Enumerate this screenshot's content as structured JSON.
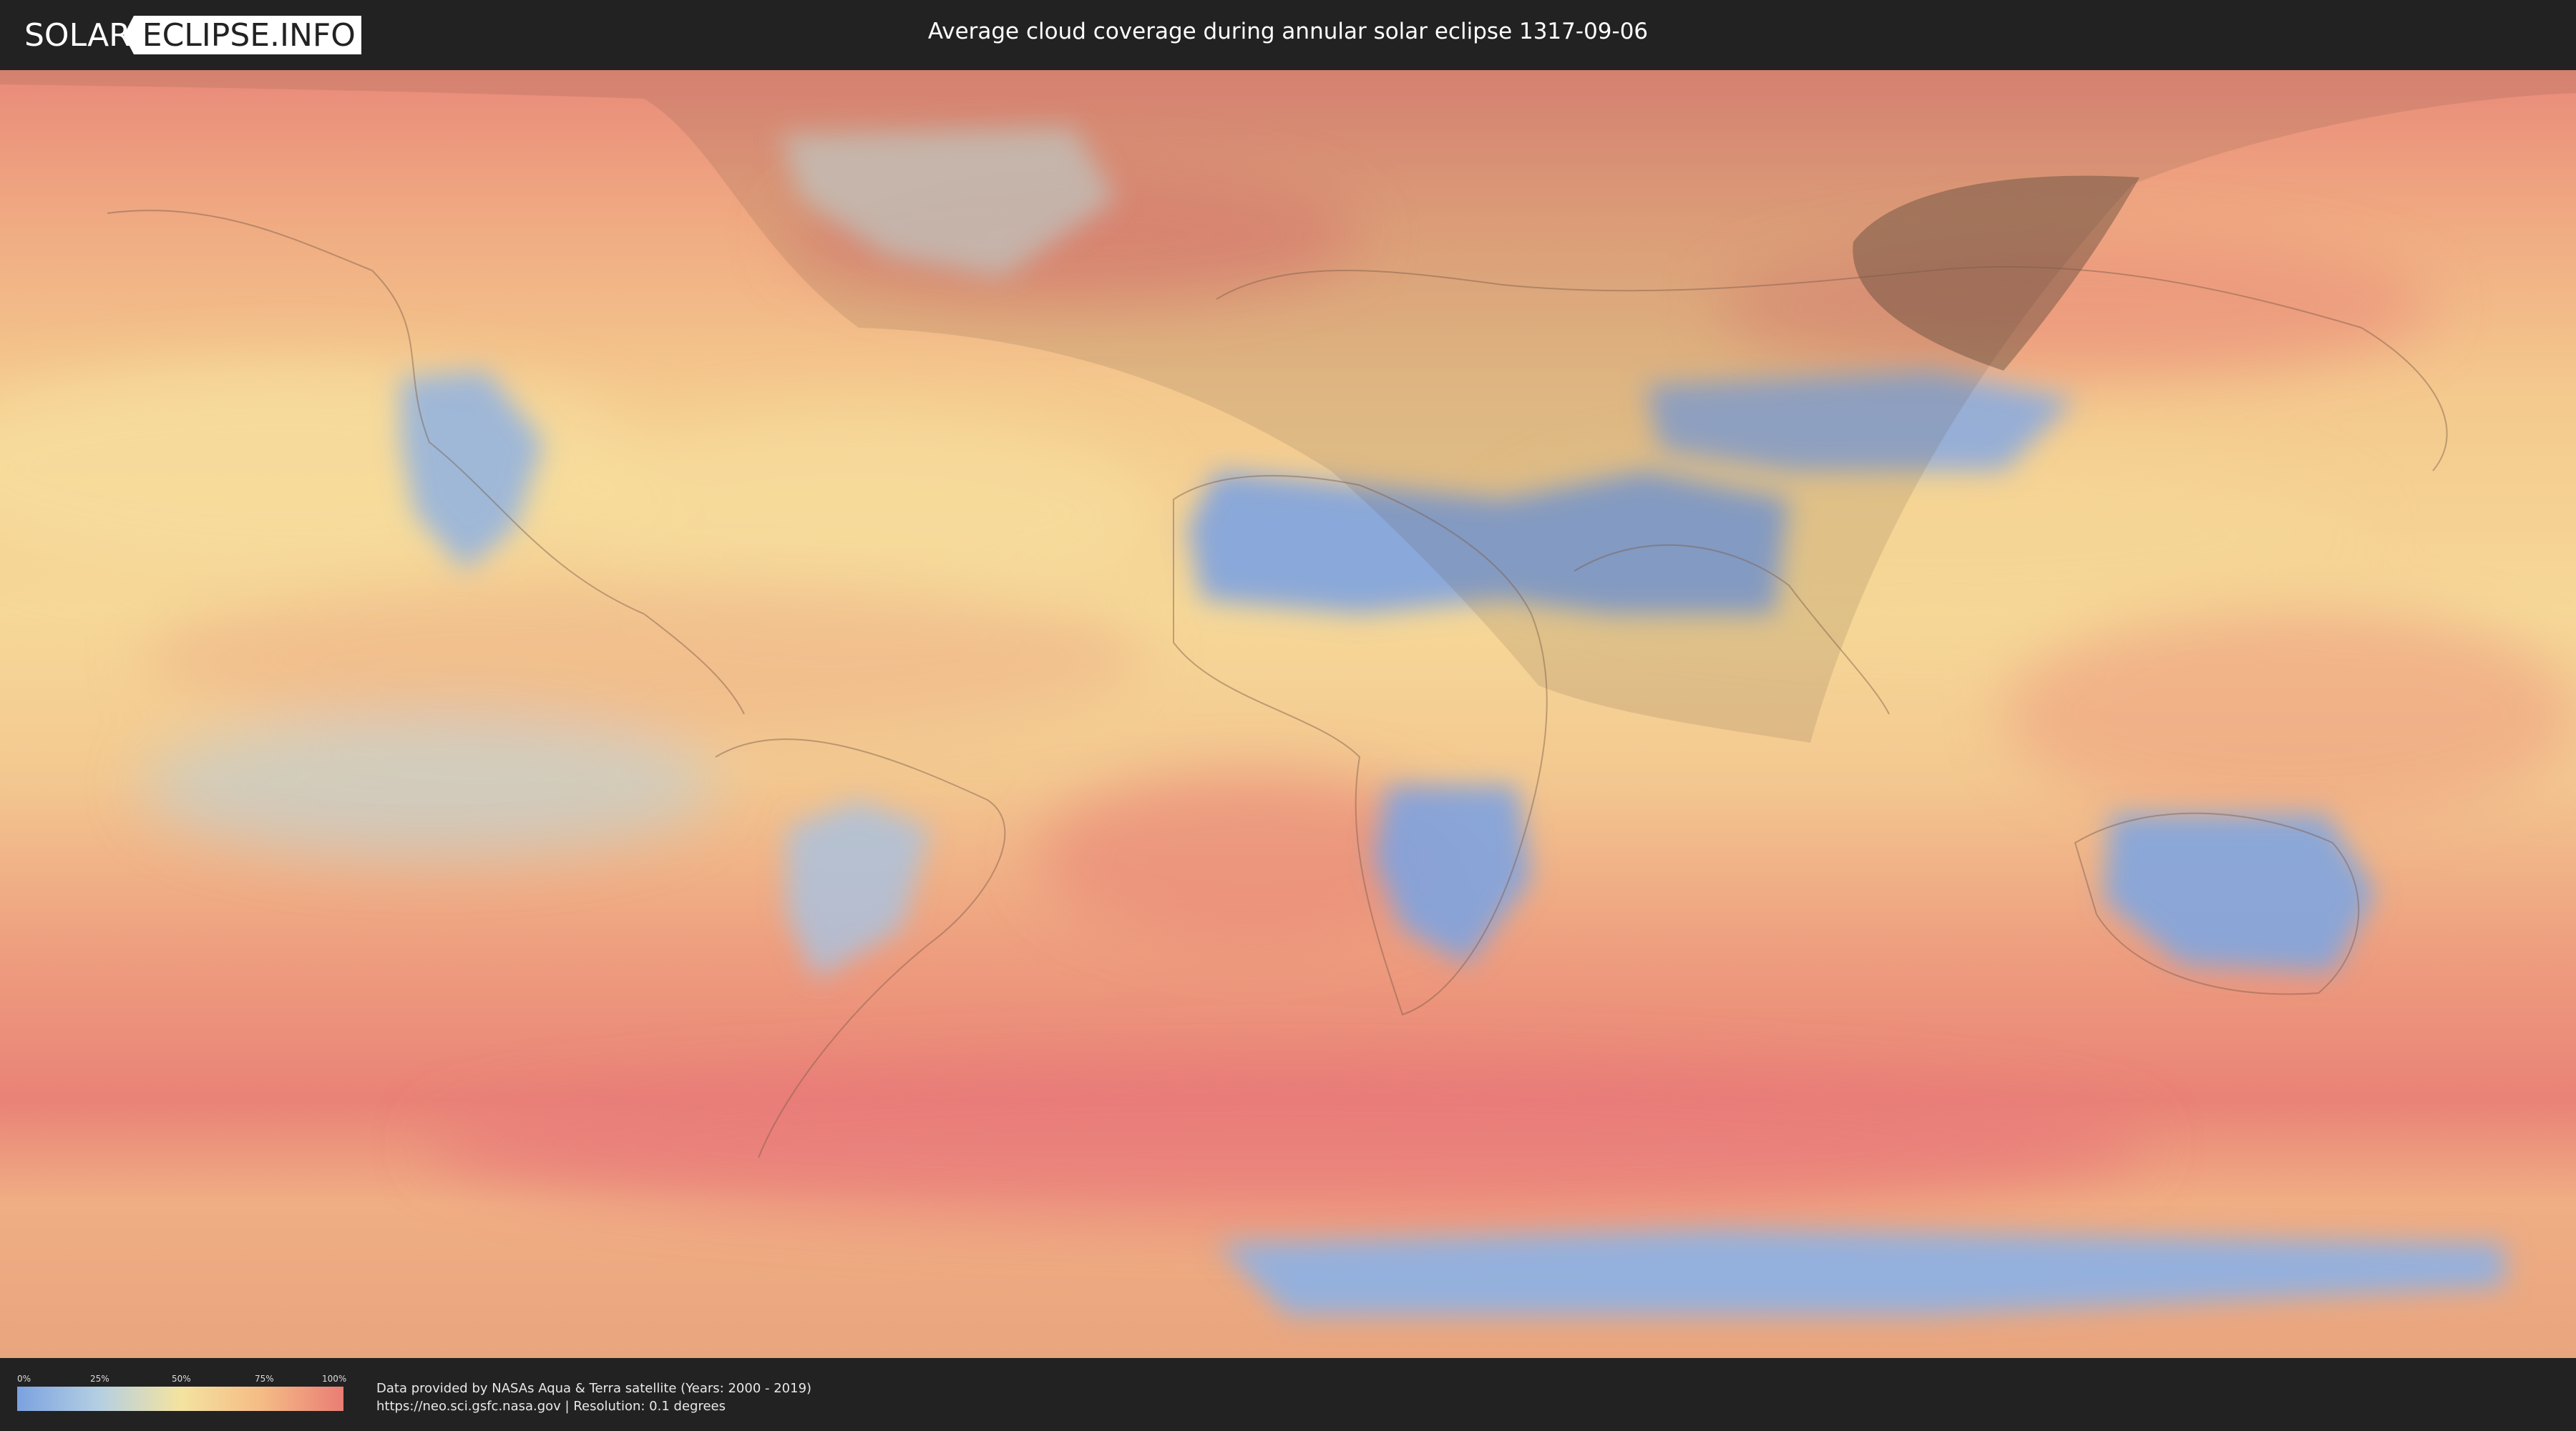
{
  "header": {
    "logo_left": "SOLAR",
    "logo_right": "ECLIPSE.INFO",
    "title": "Average cloud coverage during annular solar eclipse 1317-09-06"
  },
  "legend": {
    "ticks": [
      "0%",
      "25%",
      "50%",
      "75%",
      "100%"
    ],
    "colors": [
      "#7ba2e0",
      "#b4cfe2",
      "#f4e3a0",
      "#f5bb85",
      "#ea7d75"
    ]
  },
  "footer": {
    "credit_line1": "Data provided by NASAs Aqua & Terra satellite (Years: 2000 - 2019)",
    "credit_line2": "https://neo.sci.gsfc.nasa.gov | Resolution: 0.1 degrees"
  }
}
